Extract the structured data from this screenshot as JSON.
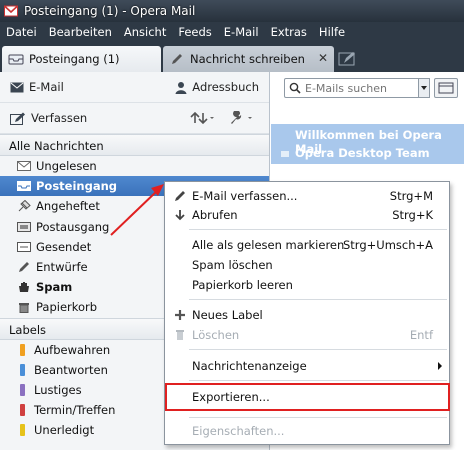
{
  "window": {
    "title": "Posteingang (1) - Opera Mail"
  },
  "menubar": [
    "Datei",
    "Bearbeiten",
    "Ansicht",
    "Feeds",
    "E-Mail",
    "Extras",
    "Hilfe"
  ],
  "tabs": [
    {
      "label": "Posteingang (1)",
      "active": true
    },
    {
      "label": "Nachricht schreiben",
      "active": false,
      "close": "✕"
    }
  ],
  "toolbar": {
    "email": "E-Mail",
    "addressbook": "Adressbuch",
    "compose": "Verfassen"
  },
  "sections": {
    "all_messages": "Alle Nachrichten",
    "labels": "Labels"
  },
  "folders": [
    {
      "label": "Ungelesen",
      "icon": "unread-envelope-icon"
    },
    {
      "label": "Posteingang",
      "icon": "inbox-icon",
      "selected": true
    },
    {
      "label": "Angeheftet",
      "icon": "pin-icon"
    },
    {
      "label": "Postausgang",
      "icon": "outbox-icon"
    },
    {
      "label": "Gesendet",
      "icon": "sent-icon"
    },
    {
      "label": "Entwürfe",
      "icon": "drafts-icon"
    },
    {
      "label": "Spam",
      "icon": "spam-hand-icon",
      "bold": true
    },
    {
      "label": "Papierkorb",
      "icon": "trash-icon"
    }
  ],
  "labels": [
    {
      "label": "Aufbewahren",
      "color": "#f0a020"
    },
    {
      "label": "Beantworten",
      "color": "#4a8fd8"
    },
    {
      "label": "Lustiges",
      "color": "#8a70c0"
    },
    {
      "label": "Termin/Treffen",
      "color": "#d04040"
    },
    {
      "label": "Unerledigt",
      "color": "#e6c21a"
    }
  ],
  "search": {
    "placeholder": "E-Mails suchen"
  },
  "mail": {
    "subject": "Willkommen bei Opera Mail",
    "sender": "Opera Desktop Team"
  },
  "context_menu": {
    "compose": {
      "label": "E-Mail verfassen...",
      "shortcut": "Strg+M"
    },
    "fetch": {
      "label": "Abrufen",
      "shortcut": "Strg+K"
    },
    "mark_all_read": {
      "label": "Alle als gelesen markieren",
      "shortcut": "Strg+Umsch+A"
    },
    "delete_spam": {
      "label": "Spam löschen"
    },
    "empty_trash": {
      "label": "Papierkorb leeren"
    },
    "new_label": {
      "label": "Neues Label"
    },
    "delete": {
      "label": "Löschen",
      "shortcut": "Entf"
    },
    "message_view": {
      "label": "Nachrichtenanzeige"
    },
    "export": {
      "label": "Exportieren..."
    },
    "properties": {
      "label": "Eigenschaften..."
    }
  },
  "colors": {
    "titlebar": "#2e3945",
    "selection": "#3a72bb",
    "highlight_box": "#e02020",
    "arrow": "#e02020"
  }
}
